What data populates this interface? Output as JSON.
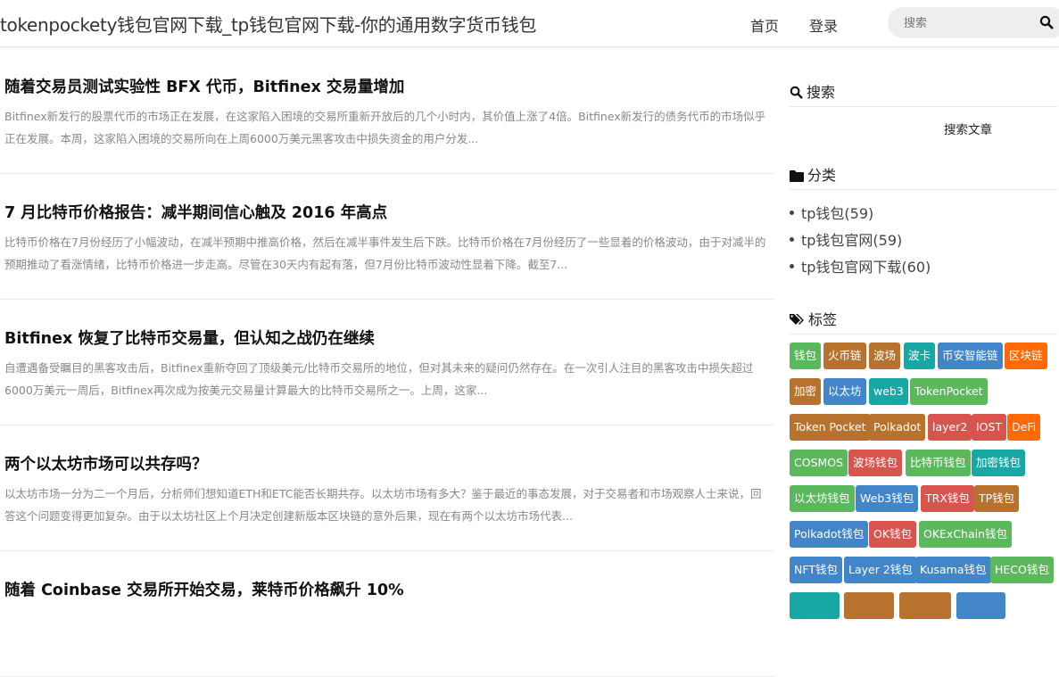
{
  "header": {
    "site_title": "tokenpockety钱包官网下载_tp钱包官网下载-你的通用数字货币钱包",
    "nav": [
      "首页",
      "登录"
    ],
    "search_placeholder": "搜索"
  },
  "posts": [
    {
      "title": "随着交易员测试实验性 BFX 代币，Bitfinex 交易量增加",
      "excerpt": "Bitfinex新发行的股票代币的市场正在发展，在这家陷入困境的交易所重新开放后的几个小时内，其价值上涨了4倍。Bitfinex新发行的债务代币的市场似乎正在发展。本周，这家陷入困境的交易所向在上周6000万美元黑客攻击中损失资金的用户分发..."
    },
    {
      "title": "7 月比特币价格报告：减半期间信心触及 2016 年高点",
      "excerpt": "比特币价格在7月份经历了小幅波动，在减半预期中推高价格，然后在减半事件发生后下跌。比特币价格在7月份经历了一些显着的价格波动，由于对减半的预期推动了看涨情绪，比特币价格进一步走高。尽管在30天内有起有落，但7月份比特币波动性显着下降。截至7..."
    },
    {
      "title": "Bitfinex 恢复了比特币交易量，但认知之战仍在继续",
      "excerpt": "自遭遇备受瞩目的黑客攻击后，Bitfinex重新夺回了顶级美元/比特币交易所的地位，但对其未来的疑问仍然存在。在一次引人注目的黑客攻击中损失超过6000万美元一周后，Bitfinex再次成为按美元交易量计算最大的比特币交易所之一。上周，这家..."
    },
    {
      "title": "两个以太坊市场可以共存吗？",
      "excerpt": "以太坊市场一分为二一个月后，分析师们想知道ETH和ETC能否长期共存。以太坊市场有多大？鉴于最近的事态发展，对于交易者和市场观察人士来说，回答这个问题变得更加复杂。由于以太坊社区上个月决定创建新版本区块链的意外后果，现在有两个以太坊市场代表..."
    },
    {
      "title": "随着 Coinbase 交易所开始交易，莱特币价格飙升 10%",
      "excerpt": ""
    }
  ],
  "sidebar": {
    "search_title": "搜索",
    "search_button": "搜索文章",
    "category_title": "分类",
    "categories": [
      "tp钱包(59)",
      "tp钱包官网(59)",
      "tp钱包官网下载(60)"
    ],
    "tags_title": "标签",
    "tags": [
      {
        "label": "钱包",
        "color": "#5cb85c"
      },
      {
        "label": "火币链",
        "color": "#b7732e"
      },
      {
        "label": "波场",
        "color": "#b7732e"
      },
      {
        "label": "波卡",
        "color": "#17a8a6"
      },
      {
        "label": "币安智能链",
        "color": "#4285c9"
      },
      {
        "label": "区块链",
        "color": "#ff6a06"
      },
      {
        "label": "加密",
        "color": "#b7732e"
      },
      {
        "label": "以太坊",
        "color": "#4285c9"
      },
      {
        "label": "web3",
        "color": "#17a8a6"
      },
      {
        "label": "TokenPocket",
        "color": "#5cb85c"
      },
      {
        "label": "Token Pocket",
        "color": "#b7732e"
      },
      {
        "label": "Polkadot",
        "color": "#b7732e"
      },
      {
        "label": "layer2",
        "color": "#d9534f"
      },
      {
        "label": "IOST",
        "color": "#d9534f"
      },
      {
        "label": "DeFi",
        "color": "#ff6a06"
      },
      {
        "label": "COSMOS",
        "color": "#5cb85c"
      },
      {
        "label": "波场钱包",
        "color": "#d9534f"
      },
      {
        "label": "比特币钱包",
        "color": "#5cb85c"
      },
      {
        "label": "加密钱包",
        "color": "#17a8a6"
      },
      {
        "label": "以太坊钱包",
        "color": "#5cb85c"
      },
      {
        "label": "Web3钱包",
        "color": "#4285c9"
      },
      {
        "label": "TRX钱包",
        "color": "#d9534f"
      },
      {
        "label": "TP钱包",
        "color": "#b7732e"
      },
      {
        "label": "Polkadot钱包",
        "color": "#4285c9"
      },
      {
        "label": "OK钱包",
        "color": "#d9534f"
      },
      {
        "label": "OKExChain钱包",
        "color": "#5cb85c"
      },
      {
        "label": "NFT钱包",
        "color": "#4285c9"
      },
      {
        "label": "Layer 2钱包",
        "color": "#4285c9"
      },
      {
        "label": "Kusama钱包",
        "color": "#4285c9"
      },
      {
        "label": "HECO钱包",
        "color": "#5cb85c"
      }
    ]
  }
}
